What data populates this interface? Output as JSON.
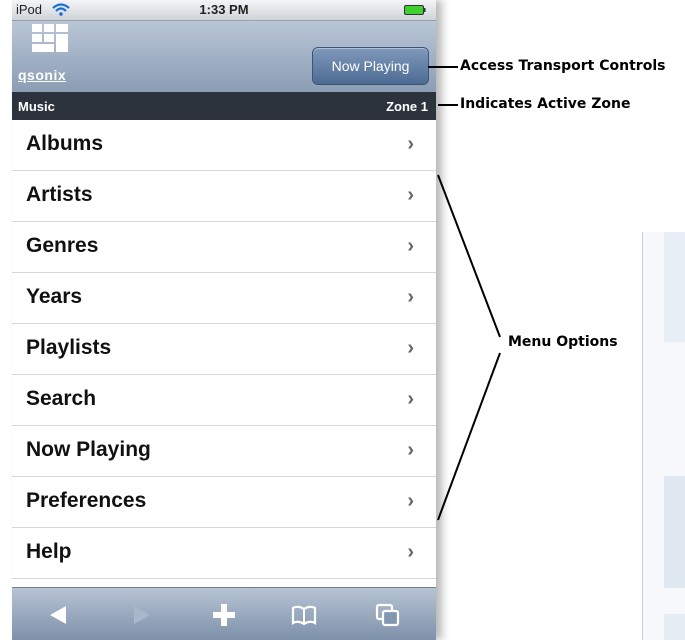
{
  "statusbar": {
    "carrier": "iPod",
    "time": "1:33 PM"
  },
  "header": {
    "logo_text": "qsonix",
    "now_playing_button": "Now Playing"
  },
  "zonebar": {
    "section": "Music",
    "zone": "Zone 1"
  },
  "menu": {
    "items": [
      {
        "label": "Albums"
      },
      {
        "label": "Artists"
      },
      {
        "label": "Genres"
      },
      {
        "label": "Years"
      },
      {
        "label": "Playlists"
      },
      {
        "label": "Search"
      },
      {
        "label": "Now Playing"
      },
      {
        "label": "Preferences"
      },
      {
        "label": "Help"
      }
    ],
    "chevron": "›"
  },
  "toolbar": {
    "icons": [
      "back-arrow-icon",
      "forward-arrow-icon",
      "add-icon",
      "bookmarks-icon",
      "pages-icon"
    ]
  },
  "annotations": {
    "transport": "Access Transport Controls",
    "zone": "Indicates Active Zone",
    "menu": "Menu Options"
  },
  "colors": {
    "zonebar": "#2c333d",
    "header": "#8b9db4",
    "button": "#5a769c"
  }
}
